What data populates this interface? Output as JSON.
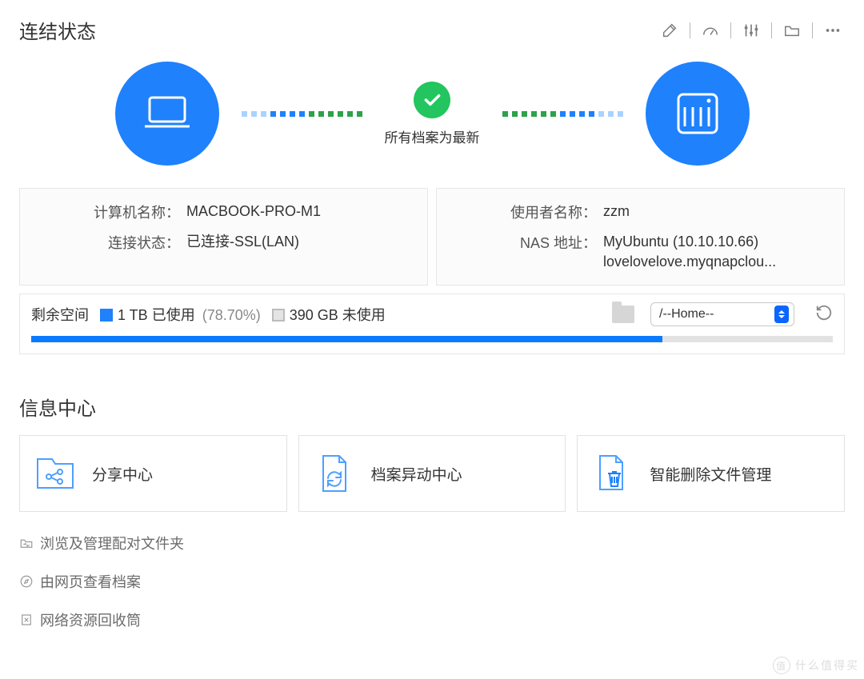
{
  "header": {
    "title": "连结状态"
  },
  "toolbar": {
    "edit": "edit-icon",
    "gauge": "gauge-icon",
    "sliders": "sliders-icon",
    "folder": "folder-icon",
    "more": "more-icon"
  },
  "connection": {
    "status_label": "所有档案为最新"
  },
  "info": {
    "computer_name_label": "计算机名称",
    "computer_name_value": "MACBOOK-PRO-M1",
    "link_status_label": "连接状态",
    "link_status_value": "已连接-SSL(LAN)",
    "user_label": "使用者名称",
    "user_value": "zzm",
    "nas_label": "NAS 地址",
    "nas_value_line1": "MyUbuntu (10.10.10.66)",
    "nas_value_line2": "lovelovelove.myqnapclou..."
  },
  "disk": {
    "caption": "剩余空间",
    "used_label": "1 TB 已使用",
    "used_pct_text": "(78.70%)",
    "used_pct_value": 78.7,
    "free_label": "390 GB 未使用",
    "select_value": "/--Home--"
  },
  "info_center": {
    "title": "信息中心"
  },
  "cards": {
    "share": "分享中心",
    "changes": "档案异动中心",
    "smart_delete": "智能删除文件管理"
  },
  "links": {
    "browse": "浏览及管理配对文件夹",
    "web": "由网页查看档案",
    "recycle": "网络资源回收筒"
  },
  "watermark": {
    "text": "什么值得买"
  },
  "colors": {
    "primary": "#1f81fc",
    "green": "#22c55e",
    "dots_green": "#2ca24a",
    "dots_blue": "#1f81fc",
    "dots_light": "#a9d3ff"
  }
}
